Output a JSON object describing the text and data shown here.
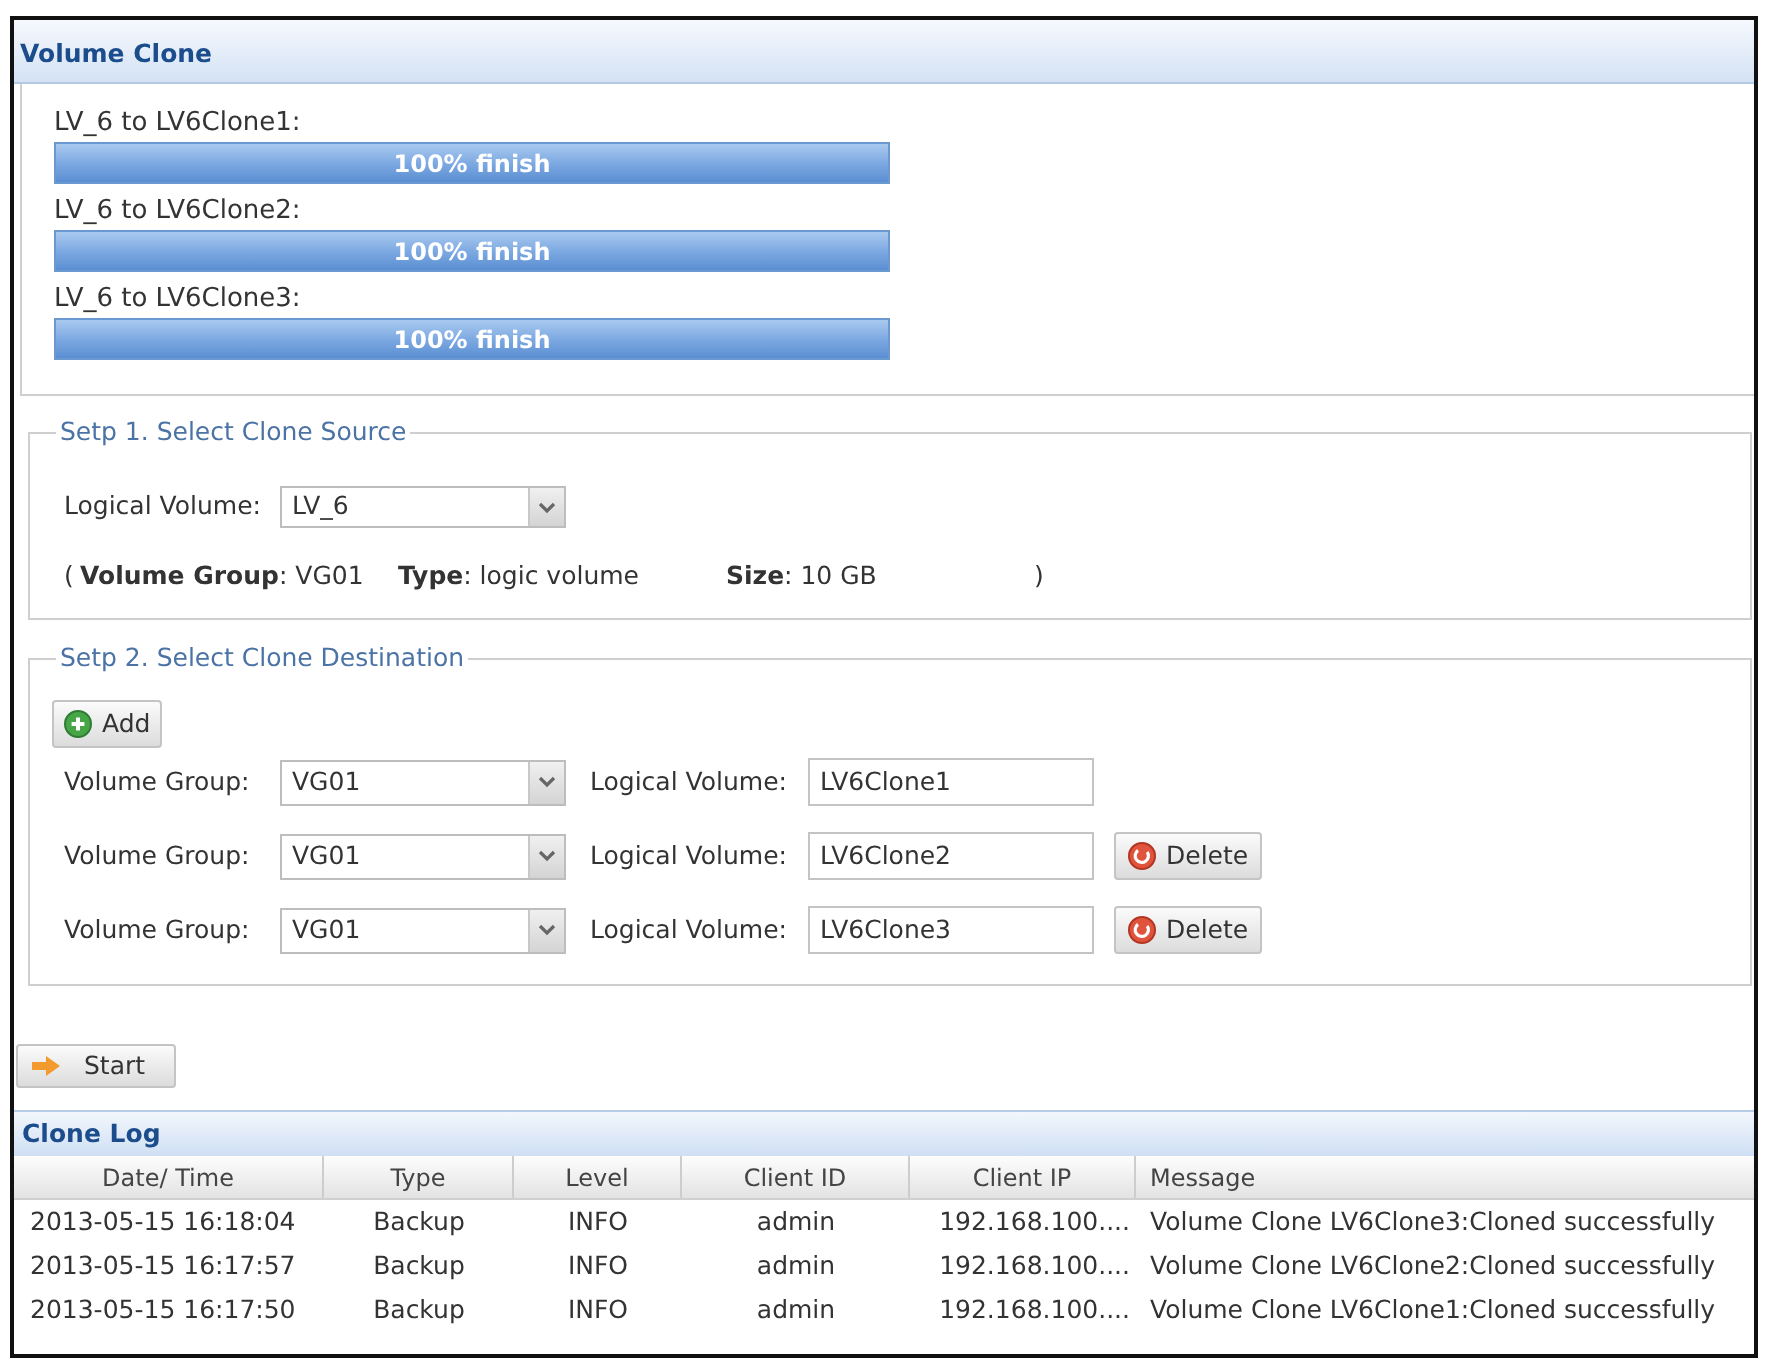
{
  "panel": {
    "title": "Volume Clone"
  },
  "progress": [
    {
      "label": "LV_6 to LV6Clone1:",
      "level": 1,
      "text": "100% finish"
    },
    {
      "label": "LV_6 to LV6Clone2:",
      "level": 1,
      "text": "100% finish"
    },
    {
      "label": "LV_6 to LV6Clone3:",
      "level": 1,
      "text": "100% finish"
    }
  ],
  "source": {
    "legend": "Setp 1. Select Clone Source",
    "field_label": "Logical Volume:",
    "field_value": "LV_6",
    "info_open": "(",
    "info": [
      "**Volume Group**: VG01",
      "**Type**: logic volume",
      "**Size**: 10 GB"
    ],
    "info_close": ")"
  },
  "destination": {
    "legend": "Setp 2. Select Clone Destination",
    "add_button": "Add",
    "rows": [
      {
        "group_label": "Volume Group:",
        "group_value": "VG01",
        "volume_label": "Logical Volume:",
        "volume_value": "LV6Clone1"
      },
      {
        "group_label": "Volume Group:",
        "group_value": "VG01",
        "volume_label": "Logical Volume:",
        "volume_value": "LV6Clone2",
        "delete_button": "Delete"
      },
      {
        "group_label": "Volume Group:",
        "group_value": "VG01",
        "volume_label": "Logical Volume:",
        "volume_value": "LV6Clone3",
        "delete_button": "Delete"
      }
    ]
  },
  "start_button": "Start",
  "log": {
    "title": "Clone Log",
    "columns": [
      "Date/ Time",
      "Type",
      "Level",
      "Client ID",
      "Client IP",
      "Message"
    ],
    "rows": [
      [
        "2013-05-15 16:18:04",
        "Backup",
        "INFO",
        "admin",
        "192.168.100....",
        "Volume Clone LV6Clone3:Cloned successfully"
      ],
      [
        "2013-05-15 16:17:57",
        "Backup",
        "INFO",
        "admin",
        "192.168.100....",
        "Volume Clone LV6Clone2:Cloned successfully"
      ],
      [
        "2013-05-15 16:17:50",
        "Backup",
        "INFO",
        "admin",
        "192.168.100....",
        "Volume Clone LV6Clone1:Cloned successfully"
      ]
    ]
  }
}
